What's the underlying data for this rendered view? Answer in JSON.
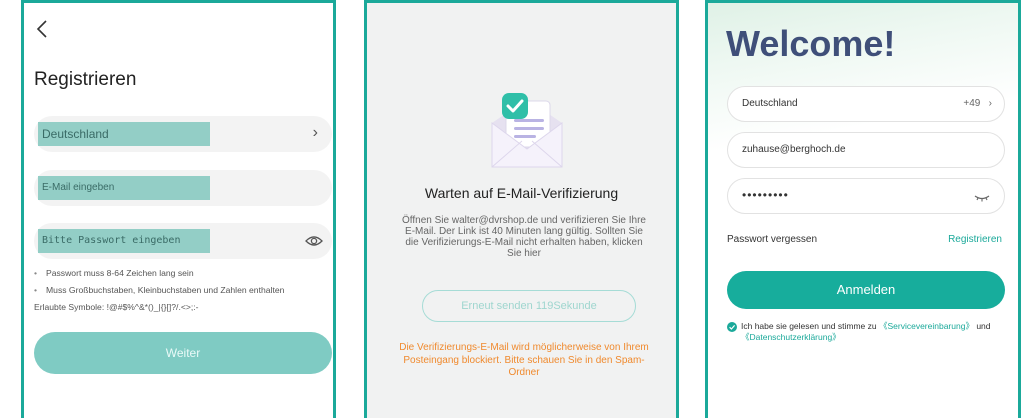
{
  "register": {
    "title": "Registrieren",
    "country_label": "Deutschland",
    "email_placeholder": "E-Mail eingeben",
    "password_placeholder": "Bitte Passwort eingeben",
    "rules": [
      "Passwort muss 8-64 Zeichen lang sein",
      "Muss Großbuchstaben, Kleinbuchstaben und Zahlen enthalten"
    ],
    "symbols_note": "Erlaubte Symbole: !@#$%^&*()_|{}[]?/.<>;:-",
    "next_label": "Weiter"
  },
  "verify": {
    "title": "Warten auf E-Mail-Verifizierung",
    "body": "Öffnen Sie walter@dvrshop.de und verifizieren Sie Ihre E-Mail. Der Link ist 40 Minuten lang gültig. Sollten Sie die Verifizierungs-E-Mail nicht erhalten haben, klicken Sie hier",
    "resend_label": "Erneut senden  119Sekunde",
    "warning": "Die Verifizierungs-E-Mail wird möglicherweise von Ihrem Posteingang blockiert. Bitte schauen Sie in den Spam-Ordner"
  },
  "login": {
    "welcome": "Welcome!",
    "country_label": "Deutschland",
    "country_code": "+49",
    "email_value": "zuhause@berghoch.de",
    "password_mask": "•••••••••",
    "forgot_label": "Passwort vergessen",
    "register_label": "Registrieren",
    "login_label": "Anmelden",
    "consent_text": "Ich habe sie gelesen und stimme zu",
    "consent_link1": "《Servicevereinbarung》",
    "consent_and": "und",
    "consent_link2": "《Datenschutzerklärung》"
  },
  "colors": {
    "accent": "#1ba99a",
    "highlight": "#93cec6",
    "warning": "#f08a2e",
    "welcome": "#3f4f79"
  }
}
